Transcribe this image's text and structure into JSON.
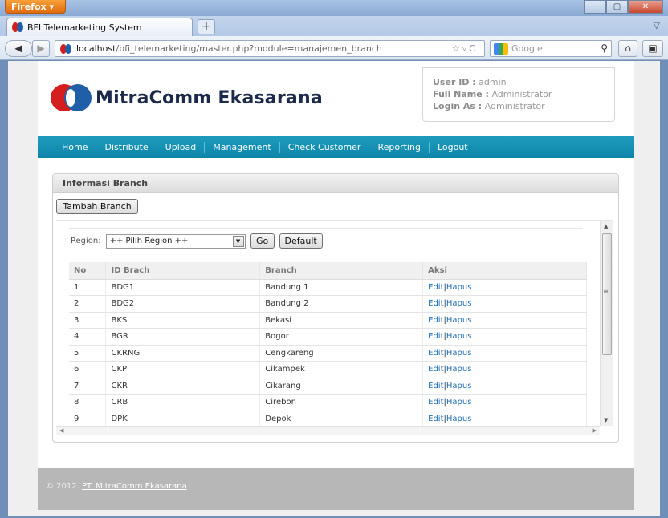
{
  "browser": {
    "app_button": "Firefox ▾",
    "tab_title": "BFI Telemarketing System",
    "url_host": "localhost",
    "url_path": "/bfi_telemarketing/master.php?module=manajemen_branch",
    "search_placeholder": "Google"
  },
  "header": {
    "logo_text": "MitraComm Ekasarana",
    "user_id_label": "User ID :",
    "user_id_value": "admin",
    "full_name_label": "Full Name :",
    "full_name_value": "Administrator",
    "login_as_label": "Login As :",
    "login_as_value": "Administrator"
  },
  "menu": [
    "Home",
    "Distribute",
    "Upload",
    "Management",
    "Check Customer",
    "Reporting",
    "Logout"
  ],
  "panel": {
    "title": "Informasi Branch",
    "add_button": "Tambah Branch",
    "region_label": "Region:",
    "region_selected": "++ Pilih Region ++",
    "go_button": "Go",
    "default_button": "Default"
  },
  "table": {
    "headers": [
      "No",
      "ID Brach",
      "Branch",
      "Aksi"
    ],
    "edit_label": "Edit",
    "delete_label": "Hapus",
    "separator": "|",
    "rows": [
      {
        "no": "1",
        "id": "BDG1",
        "branch": "Bandung 1"
      },
      {
        "no": "2",
        "id": "BDG2",
        "branch": "Bandung 2"
      },
      {
        "no": "3",
        "id": "BKS",
        "branch": "Bekasi"
      },
      {
        "no": "4",
        "id": "BGR",
        "branch": "Bogor"
      },
      {
        "no": "5",
        "id": "CKRNG",
        "branch": "Cengkareng"
      },
      {
        "no": "6",
        "id": "CKP",
        "branch": "Cikampek"
      },
      {
        "no": "7",
        "id": "CKR",
        "branch": "Cikarang"
      },
      {
        "no": "8",
        "id": "CRB",
        "branch": "Cirebon"
      },
      {
        "no": "9",
        "id": "DPK",
        "branch": "Depok"
      }
    ]
  },
  "footer": {
    "copyright": "© 2012.",
    "company_link": "PT. MitraComm Ekasarana"
  },
  "colors": {
    "menu_bar": "#1592b6",
    "link": "#1f6fb5",
    "logo_red": "#d51e1e",
    "logo_blue": "#1f5fa8"
  }
}
